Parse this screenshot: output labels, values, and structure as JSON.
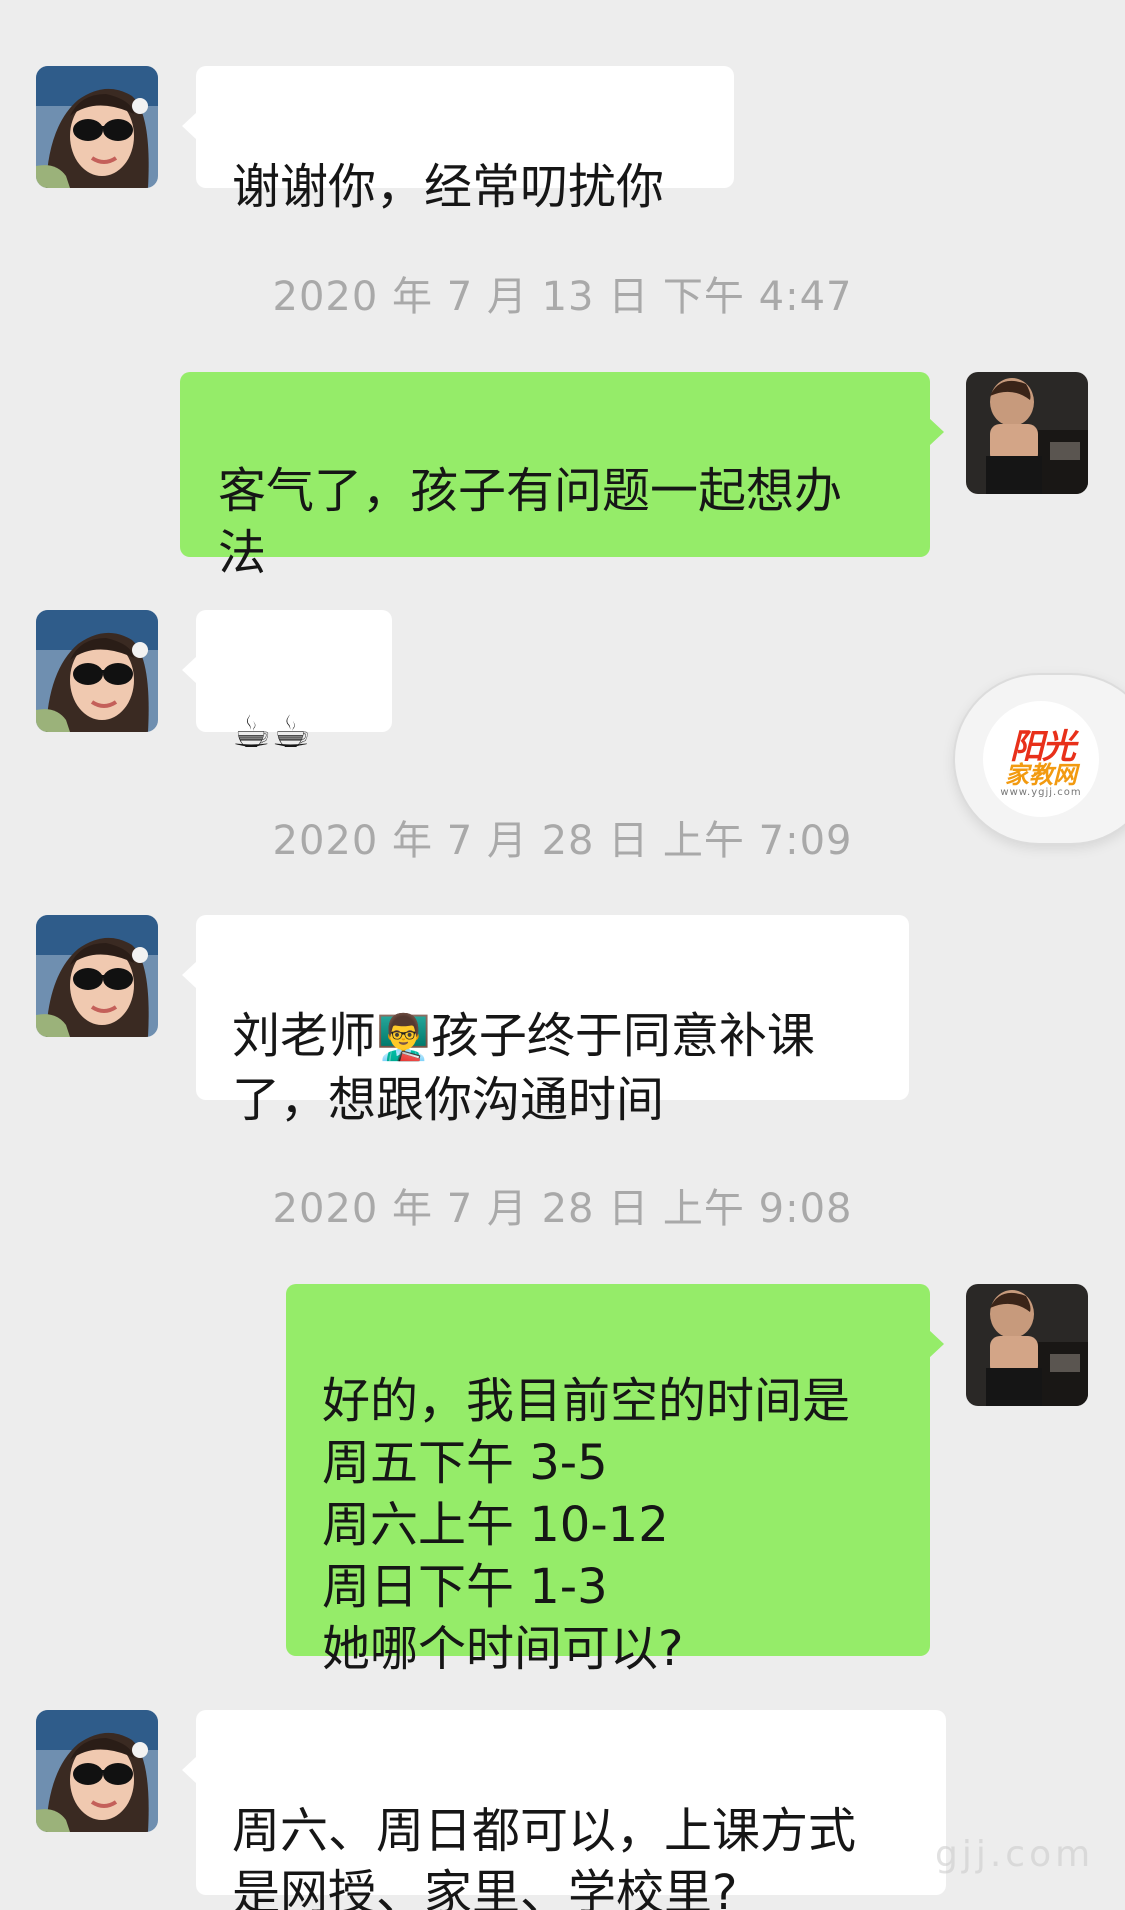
{
  "top_fragment": "",
  "messages": [
    {
      "side": "left",
      "text": "谢谢你，经常叨扰你"
    },
    {
      "side": "timestamp",
      "text": "2020 年 7 月 13 日 下午 4:47"
    },
    {
      "side": "right",
      "text": "客气了，孩子有问题一起想办\n法"
    },
    {
      "side": "left",
      "emoji": "☕☕"
    },
    {
      "side": "timestamp",
      "text": "2020 年 7 月 28 日 上午 7:09"
    },
    {
      "side": "left",
      "text_before": "刘老师",
      "emoji": "👨‍🏫",
      "text_after": "孩子终于同意补课\n了，想跟你沟通时间"
    },
    {
      "side": "timestamp",
      "text": "2020 年 7 月 28 日 上午 9:08"
    },
    {
      "side": "right",
      "text": "好的，我目前空的时间是\n周五下午 3-5\n周六上午 10-12\n周日下午 1-3\n她哪个时间可以?"
    },
    {
      "side": "left",
      "text": "周六、周日都可以，上课方式\n是网授、家里、学校里?"
    }
  ],
  "floating_logo": {
    "line1": "阳光",
    "line2": "家教网",
    "url": "www.ygjj.com"
  },
  "watermark": "gjj.com",
  "colors": {
    "background": "#ededed",
    "left_bubble": "#ffffff",
    "right_bubble": "#95ec69",
    "timestamp": "#a9a9a9"
  }
}
